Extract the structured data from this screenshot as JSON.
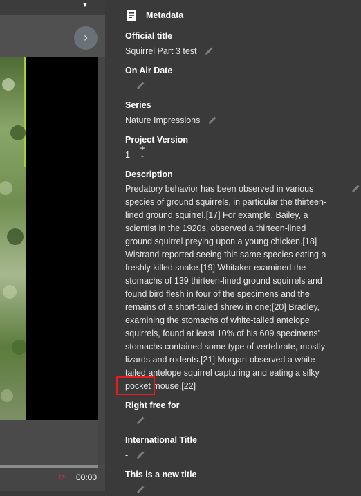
{
  "header": {
    "title": "Metadata"
  },
  "player": {
    "time": "00:00"
  },
  "fields": {
    "official_title": {
      "label": "Official title",
      "value": "Squirrel Part 3 test"
    },
    "on_air_date": {
      "label": "On Air Date",
      "value": "-"
    },
    "series": {
      "label": "Series",
      "value": "Nature Impressions"
    },
    "project_version": {
      "label": "Project Version",
      "value": "1",
      "plus": "+",
      "minus": "-"
    },
    "description": {
      "label": "Description",
      "lines": [
        "Predatory behavior has been observed in various",
        "species of ground squirrels, in particular the thirteen-",
        "lined ground squirrel.[17] For example, Bailey, a",
        "scientist in the 1920s, observed a thirteen-lined",
        "ground squirrel preying upon a young chicken.[18]",
        "Wistrand reported seeing this same species eating a",
        "freshly killed snake.[19] Whitaker examined the",
        "stomachs of 139 thirteen-lined ground squirrels and",
        "found bird flesh in four of the specimens and the",
        "remains of a short-tailed shrew in one;[20] Bradley,",
        "examining the stomachs of white-tailed antelope",
        "squirrels, found at least 10% of his 609 specimens'",
        "stomachs contained some type of vertebrate, mostly",
        "lizards and rodents.[21] Morgart observed a white-",
        "tailed antelope squirrel capturing and eating a silky",
        "pocket mouse.[22]"
      ]
    },
    "right_free_for": {
      "label": "Right free for",
      "value": "-"
    },
    "international_title": {
      "label": "International Title",
      "value": "-"
    },
    "new_title": {
      "label": "This is a new title",
      "value": "-"
    }
  }
}
